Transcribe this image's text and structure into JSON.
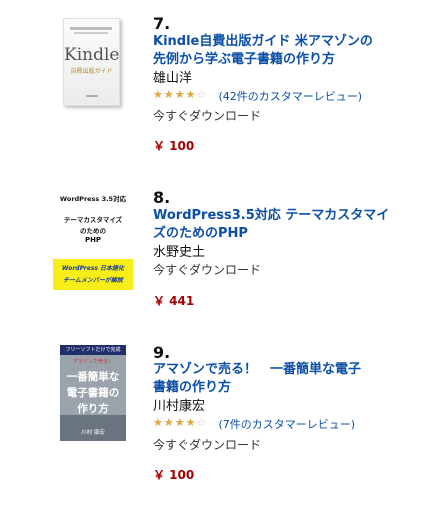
{
  "results": [
    {
      "rank": "7.",
      "title_line1": "Kindle自費出版ガイド 米アマゾンの",
      "title_line2": "先例から学ぶ電子書籍の作り方",
      "author": "雄山洋",
      "rating": 3.5,
      "review_text": "(42件のカスタマーレビュー)",
      "availability": "今すぐダウンロード",
      "price": "￥ 100",
      "cover": {
        "title": "Kindle",
        "subtitle": "自費出版ガイド"
      }
    },
    {
      "rank": "8.",
      "title_line1": "WordPress3.5対応 テーマカスタマイ",
      "title_line2": "ズのためのPHP",
      "author": "水野史土",
      "availability": "今すぐダウンロード",
      "price": "￥ 441",
      "cover": {
        "line1": "WordPress 3.5対応",
        "line2": "テーマカスタマイズ",
        "line3": "のための",
        "line4": "PHP",
        "band1": "WordPress 日本語化",
        "band2": "チームメンバーが解説"
      }
    },
    {
      "rank": "9.",
      "title_line1": "アマゾンで売る！　一番簡単な電子",
      "title_line2": "書籍の作り方",
      "author": "川村康宏",
      "rating": 3.5,
      "review_text": "(7件のカスタマーレビュー)",
      "availability": "今すぐダウンロード",
      "price": "￥ 100",
      "cover": {
        "top": "フリーソフトだけで完成",
        "red": "アマゾンで売る！",
        "m1": "一番簡単な",
        "m2": "電子書籍の",
        "m3": "作り方",
        "author": "川村 康宏"
      }
    }
  ],
  "colors": {
    "link": "#0b4fa8",
    "price": "#a80000",
    "star": "#e3a93a"
  }
}
